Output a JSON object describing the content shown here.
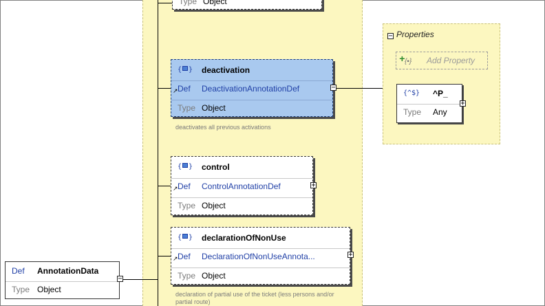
{
  "root_node": {
    "def_keyword": "Def",
    "def_value": "AnnotationData",
    "type_keyword": "Type",
    "type_value": "Object"
  },
  "top_partial_node": {
    "type_keyword": "Type",
    "type_value": "Object"
  },
  "nodes": [
    {
      "name": "deactivation",
      "def_keyword": "Def",
      "def_value": "DeactivationAnnotationDef",
      "type_keyword": "Type",
      "type_value": "Object",
      "description": "deactivates all previous activations",
      "selected": true,
      "expanded": true
    },
    {
      "name": "control",
      "def_keyword": "Def",
      "def_value": "ControlAnnotationDef",
      "type_keyword": "Type",
      "type_value": "Object",
      "description": "",
      "selected": false,
      "expanded": false
    },
    {
      "name": "declarationOfNonUse",
      "def_keyword": "Def",
      "def_value": "DeclarationOfNonUseAnnota...",
      "type_keyword": "Type",
      "type_value": "Object",
      "description": "declaration of partial use of the ticket (less persons and/or partial route)",
      "selected": false,
      "expanded": false
    }
  ],
  "properties_panel": {
    "title": "Properties",
    "add_property_label": "Add Property",
    "pattern_node": {
      "icon_text": "{^$}",
      "name": "^P_",
      "type_keyword": "Type",
      "type_value": "Any"
    }
  },
  "icons": {
    "property": "property-icon",
    "reference": "reference-arrow-icon",
    "collapse": "collapse-icon",
    "expand": "expand-icon",
    "add": "add-property-icon"
  },
  "colors": {
    "selection": "#a9c9ef",
    "band": "#fcf7c0",
    "keyword": "#1f3fa6"
  }
}
